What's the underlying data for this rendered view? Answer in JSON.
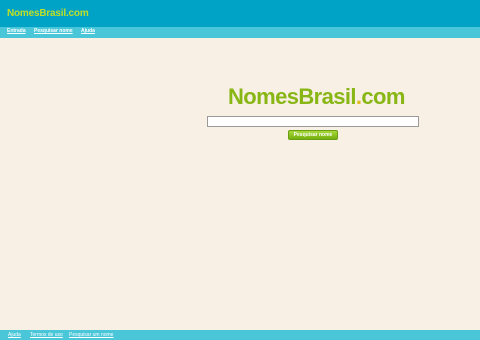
{
  "header": {
    "logo": {
      "name": "NomesBrasil",
      "dot": ".",
      "tld": "com"
    }
  },
  "nav": {
    "items": [
      {
        "label": "Entrada"
      },
      {
        "label": "Pesquisar nome"
      },
      {
        "label": "Ajuda"
      }
    ]
  },
  "main": {
    "logo": {
      "name": "NomesBrasil",
      "dot": ".",
      "tld": "com"
    },
    "search": {
      "value": "",
      "placeholder": ""
    },
    "search_button_label": "Pesquisar nome"
  },
  "footer": {
    "links": [
      {
        "label": "Ajuda"
      },
      {
        "label": "Termos de uso"
      },
      {
        "label": "Pesquisar um nome"
      }
    ]
  },
  "colors": {
    "header_bg": "#00a2c6",
    "nav_bg": "#49c7d8",
    "page_bg": "#f8f0e4",
    "brand_green": "#88b615",
    "brand_lime": "#bedf28",
    "brand_dot": "#e0ba20"
  }
}
